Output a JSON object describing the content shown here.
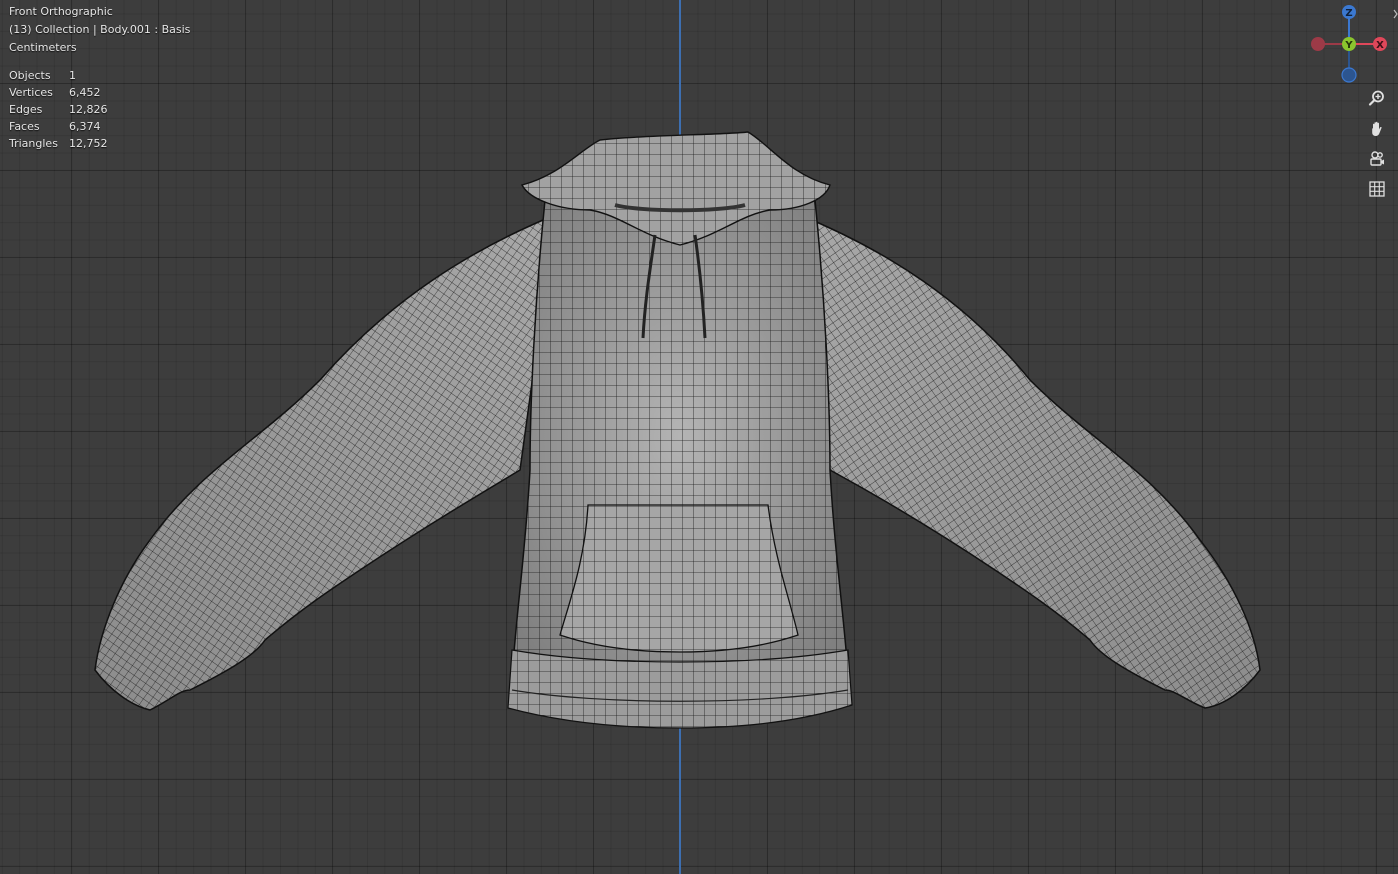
{
  "viewport": {
    "view_name": "Front Orthographic",
    "collection_info": "(13) Collection | Body.001 : Basis",
    "units": "Centimeters"
  },
  "stats": [
    {
      "label": "Objects",
      "value": "1"
    },
    {
      "label": "Vertices",
      "value": "6,452"
    },
    {
      "label": "Edges",
      "value": "12,826"
    },
    {
      "label": "Faces",
      "value": "6,374"
    },
    {
      "label": "Triangles",
      "value": "12,752"
    }
  ],
  "gizmo": {
    "z_label": "Z",
    "y_label": "Y",
    "x_label": "X",
    "colors": {
      "x": "#e0475a",
      "y": "#8ac52e",
      "z": "#3b78d0"
    }
  },
  "nav_icons": [
    "zoom-icon",
    "pan-hand-icon",
    "camera-icon",
    "grid-icon"
  ],
  "colors": {
    "background": "#3d3d3d",
    "mesh": "#9a9a9a",
    "wire": "#1a1a1a",
    "z_axis": "#3d6fb1"
  }
}
